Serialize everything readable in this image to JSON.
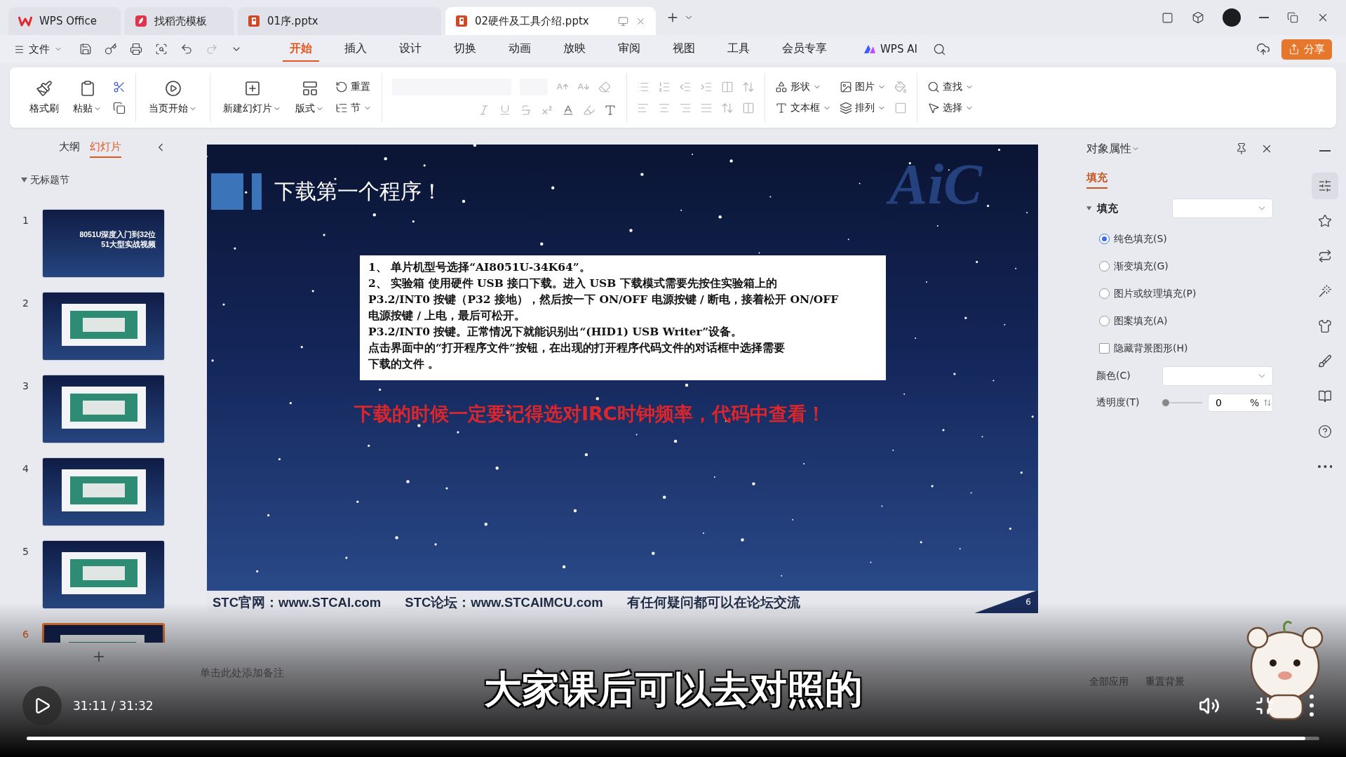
{
  "title_bar": {
    "tabs": [
      {
        "label": "WPS Office",
        "kind": "home",
        "selected": false
      },
      {
        "label": "找稻壳模板",
        "kind": "docer",
        "selected": false
      },
      {
        "label": "01序.pptx",
        "kind": "ppt",
        "selected": false
      },
      {
        "label": "02硬件及工具介绍.pptx",
        "kind": "ppt",
        "selected": true
      }
    ]
  },
  "menu_bar": {
    "file": "文件",
    "tabs": [
      {
        "label": "开始",
        "selected": true
      },
      {
        "label": "插入",
        "selected": false
      },
      {
        "label": "设计",
        "selected": false
      },
      {
        "label": "切换",
        "selected": false
      },
      {
        "label": "动画",
        "selected": false
      },
      {
        "label": "放映",
        "selected": false
      },
      {
        "label": "审阅",
        "selected": false
      },
      {
        "label": "视图",
        "selected": false
      },
      {
        "label": "工具",
        "selected": false
      },
      {
        "label": "会员专享",
        "selected": false
      }
    ],
    "ai": "WPS AI",
    "share": "分享"
  },
  "ribbon": {
    "format_painter": "格式刷",
    "paste": "粘贴",
    "from_current": "当页开始",
    "new_slide": "新建幻灯片",
    "layout": "版式",
    "reset": "重置",
    "section": "节",
    "shape": "形状",
    "picture": "图片",
    "textbox": "文本框",
    "arrange": "排列",
    "find": "查找",
    "select": "选择"
  },
  "left_panel": {
    "tabs": [
      {
        "label": "大纲",
        "selected": false
      },
      {
        "label": "幻灯片",
        "selected": true
      }
    ],
    "section": "无标题节",
    "slides": [
      {
        "number": "1",
        "selected": false,
        "title_lines": [
          "8051U深度入门到32位",
          "51大型实战视频"
        ]
      },
      {
        "number": "2",
        "selected": false
      },
      {
        "number": "3",
        "selected": false
      },
      {
        "number": "4",
        "selected": false
      },
      {
        "number": "5",
        "selected": false
      },
      {
        "number": "6",
        "selected": true
      }
    ]
  },
  "slide": {
    "title": "下载第一个程序！",
    "logo": "AiC",
    "body_lines": [
      "1、 单片机型号选择“AI8051U-34K64”。",
      "2、 实验箱 使用硬件 USB 接口下载。进入 USB 下载模式需要先按住实验箱上的",
      "P3.2/INT0 按键（P32 接地），然后按一下 ON/OFF 电源按键 / 断电，接着松开 ON/OFF",
      "电源按键 / 上电，最后可松开。",
      "P3.2/INT0 按键。正常情况下就能识别出“(HID1) USB Writer”设备。",
      "点击界面中的“打开程序文件”按钮，在出现的打开程序代码文件的对话框中选择需要",
      "下载的文件 。"
    ],
    "note": "下载的时候一定要记得选对IRC时钟频率，代码中查看！",
    "footer": [
      "STC官网：www.STCAI.com",
      "STC论坛：www.STCAIMCU.com",
      "有任何疑问都可以在论坛交流"
    ],
    "number": "6"
  },
  "notes": {
    "placeholder": "单击此处添加备注"
  },
  "properties_panel": {
    "title": "对象属性",
    "tabs": [
      {
        "label": "填充",
        "selected": true
      }
    ],
    "section": "填充",
    "fill_options": [
      {
        "label": "纯色填充(S)",
        "kind": "radio",
        "selected": true
      },
      {
        "label": "渐变填充(G)",
        "kind": "radio",
        "selected": false
      },
      {
        "label": "图片或纹理填充(P)",
        "kind": "radio",
        "selected": false
      },
      {
        "label": "图案填充(A)",
        "kind": "radio",
        "selected": false
      },
      {
        "label": "隐藏背景图形(H)",
        "kind": "checkbox",
        "checked": false
      }
    ],
    "color_label": "颜色(C)",
    "transparency": {
      "label": "透明度(T)",
      "level": 0,
      "value": "0",
      "unit": "%"
    },
    "buttons": [
      "全部应用",
      "重置背景"
    ]
  },
  "player": {
    "subtitle": "大家课后可以去对照的",
    "time": "31:11 / 31:32",
    "progress": {
      "level": 0.989
    }
  }
}
